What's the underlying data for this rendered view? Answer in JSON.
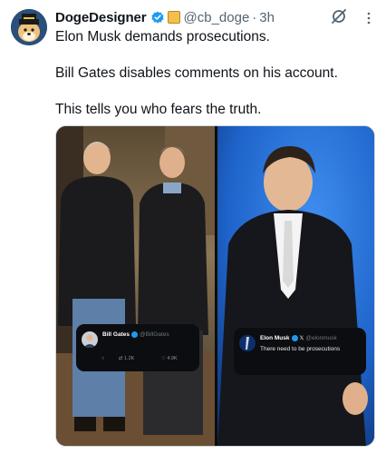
{
  "author": {
    "name": "DogeDesigner",
    "handle": "@cb_doge",
    "separator": "·",
    "time": "3h"
  },
  "icons": {
    "avatar": "doge-avatar",
    "verified": "verified-badge-icon",
    "affiliate": "affiliate-badge-icon",
    "grok": "grok-icon",
    "more": "more-options-icon"
  },
  "tweet": {
    "line1": "Elon Musk demands prosecutions.",
    "line2": "Bill Gates disables comments on his account.",
    "line3": "This tells you who fears the truth."
  },
  "media": {
    "left_card": {
      "name": "Bill Gates",
      "handle": "@BillGates",
      "retweets": "1.2K",
      "likes": "4.9K"
    },
    "right_card": {
      "name": "Elon Musk",
      "handle": "@elonmusk",
      "text": "There need to be prosecutions"
    }
  },
  "colors": {
    "text": "#0f1419",
    "secondary": "#536471",
    "verified": "#1d9bf0",
    "card_bg": "#0b0d10",
    "stage_blue": "#1e63c9"
  }
}
